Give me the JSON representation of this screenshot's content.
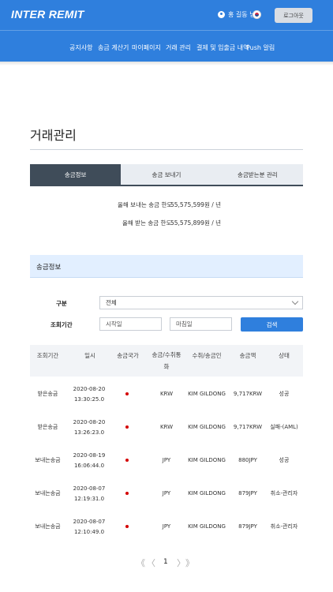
{
  "header": {
    "logo": "INTER REMIT",
    "user_name": "홍 길동 님",
    "logout_label": "로그아웃"
  },
  "nav": [
    "공지사항",
    "송금 계산기",
    "마이페이지",
    "거래 관리",
    "결제 및 입출금 내역",
    "Push 알림"
  ],
  "page": {
    "title": "거래관리"
  },
  "tabs": [
    "송금정보",
    "송금 보내기",
    "송금받는분 관리"
  ],
  "limits": {
    "send_label": "올해 보내는 송금 한도",
    "send_value": "55,575,599원 / 년",
    "receive_label": "올해 받는 송금 한도",
    "receive_value": "55,575,899원 / 년"
  },
  "section": {
    "title": "송금정보"
  },
  "filters": {
    "type_label": "구분",
    "type_value": "전체",
    "period_label": "조회기간",
    "start_placeholder": "시작일",
    "end_placeholder": "마침일",
    "search_label": "검색"
  },
  "table": {
    "headers": [
      "조회기간",
      "일시",
      "송금국가",
      "송금/수취통화",
      "수취/송금인",
      "송금액",
      "상태"
    ],
    "rows": [
      {
        "type": "받은송금",
        "date": "2020-08-20",
        "time": "13:30:25.0",
        "currency": "KRW",
        "name": "KIM GILDONG",
        "amount": "9,717KRW",
        "status": "성공"
      },
      {
        "type": "받은송금",
        "date": "2020-08-20",
        "time": "13:26:23.0",
        "currency": "KRW",
        "name": "KIM GILDONG",
        "amount": "9,717KRW",
        "status": "실패-(AML)"
      },
      {
        "type": "보내는송금",
        "date": "2020-08-19",
        "time": "16:06:44.0",
        "currency": "JPY",
        "name": "KIM GILDONG",
        "amount": "880JPY",
        "status": "성공"
      },
      {
        "type": "보내는송금",
        "date": "2020-08-07",
        "time": "12:19:31.0",
        "currency": "JPY",
        "name": "KIM GILDONG",
        "amount": "879JPY",
        "status": "취소-관리자"
      },
      {
        "type": "보내는송금",
        "date": "2020-08-07",
        "time": "12:10:49.0",
        "currency": "JPY",
        "name": "KIM GILDONG",
        "amount": "879JPY",
        "status": "취소-관리자"
      }
    ]
  },
  "pagination": {
    "first": "《",
    "prev": "〈",
    "current": "1",
    "next": "〉",
    "last": "》"
  },
  "colors": {
    "primary": "#2f7fdd",
    "tab_active": "#3f4c59",
    "section_bg": "#e2efff",
    "flag_dot": "#d40000"
  }
}
